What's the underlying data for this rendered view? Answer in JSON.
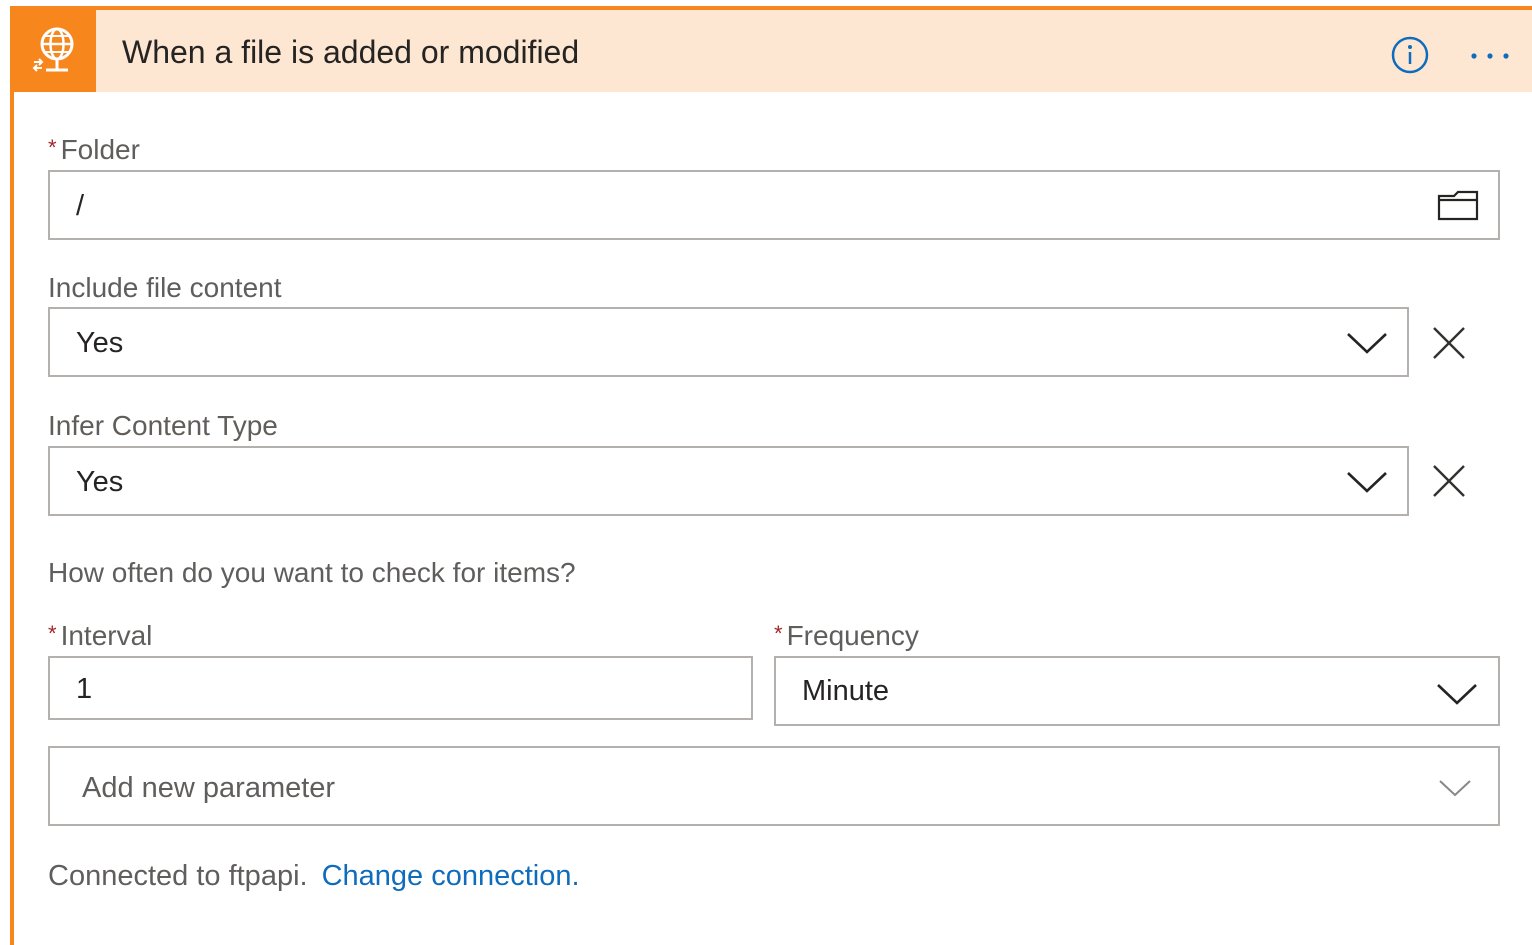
{
  "header": {
    "title": "When a file is added or modified",
    "icon": "ftp-globe-icon",
    "accent_color": "#f7861c",
    "header_bg": "#fde7d2"
  },
  "folder": {
    "label": "Folder",
    "required": true,
    "value": "/"
  },
  "include_file_content": {
    "label": "Include file content",
    "value": "Yes"
  },
  "infer_content_type": {
    "label": "Infer Content Type",
    "value": "Yes"
  },
  "recurrence": {
    "question": "How often do you want to check for items?",
    "interval": {
      "label": "Interval",
      "required": true,
      "value": "1"
    },
    "frequency": {
      "label": "Frequency",
      "required": true,
      "value": "Minute"
    }
  },
  "add_parameter": {
    "placeholder": "Add new parameter"
  },
  "footer": {
    "connected_text": "Connected to ftpapi.",
    "change_link": "Change connection."
  },
  "colors": {
    "required_marker": "#a4262c",
    "link": "#0f6cbd"
  }
}
